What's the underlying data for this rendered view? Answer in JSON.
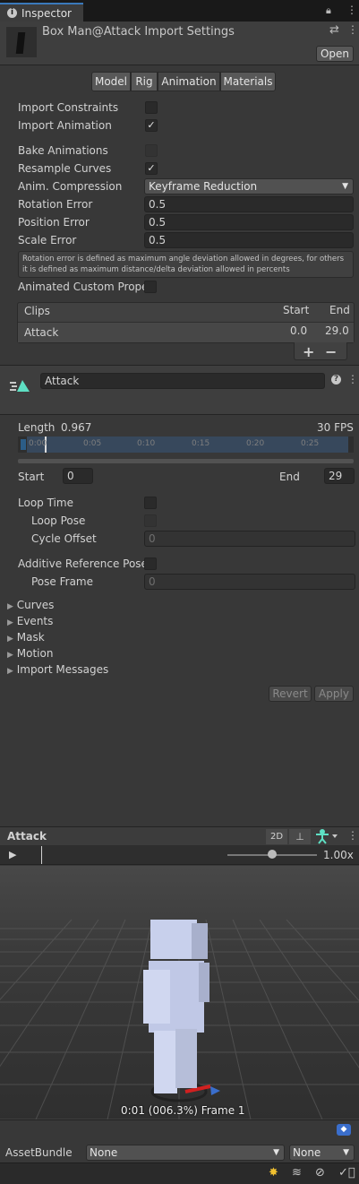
{
  "tab": {
    "title": "Inspector"
  },
  "header": {
    "title": "Box Man@Attack Import Settings",
    "open_label": "Open"
  },
  "tabs": [
    "Model",
    "Rig",
    "Animation",
    "Materials"
  ],
  "settings": {
    "import_constraints": "Import Constraints",
    "import_animation": "Import Animation",
    "bake_animations": "Bake Animations",
    "resample_curves": "Resample Curves",
    "anim_compression": "Anim. Compression",
    "anim_compression_value": "Keyframe Reduction",
    "rotation_error": "Rotation Error",
    "rotation_error_value": "0.5",
    "position_error": "Position Error",
    "position_error_value": "0.5",
    "scale_error": "Scale Error",
    "scale_error_value": "0.5",
    "help_text": "Rotation error is defined as maximum angle deviation allowed in degrees, for others it is defined as maximum distance/delta deviation allowed in percents",
    "animated_custom": "Animated Custom Proper"
  },
  "clips": {
    "header": "Clips",
    "start_header": "Start",
    "end_header": "End",
    "rows": [
      {
        "name": "Attack",
        "start": "0.0",
        "end": "29.0"
      }
    ],
    "add": "+",
    "remove": "−"
  },
  "clip": {
    "name": "Attack",
    "length_label": "Length",
    "length_value": "0.967",
    "fps": "30 FPS",
    "ticks": [
      "0:00",
      "0:05",
      "0:10",
      "0:15",
      "0:20",
      "0:25"
    ],
    "start_label": "Start",
    "start_value": "0",
    "end_label": "End",
    "end_value": "29",
    "loop_time": "Loop Time",
    "loop_pose": "Loop Pose",
    "cycle_offset": "Cycle Offset",
    "cycle_offset_value": "0",
    "additive_ref": "Additive Reference Pose",
    "pose_frame": "Pose Frame",
    "pose_frame_value": "0"
  },
  "foldouts": [
    "Curves",
    "Events",
    "Mask",
    "Motion",
    "Import Messages"
  ],
  "actions": {
    "revert": "Revert",
    "apply": "Apply"
  },
  "preview": {
    "title": "Attack",
    "mode_2d": "2D",
    "speed": "1.00x",
    "status": "0:01 (006.3%) Frame 1",
    "speed_fraction": 0.5
  },
  "assetbundle": {
    "label": "AssetBundle",
    "value": "None",
    "variant": "None"
  }
}
